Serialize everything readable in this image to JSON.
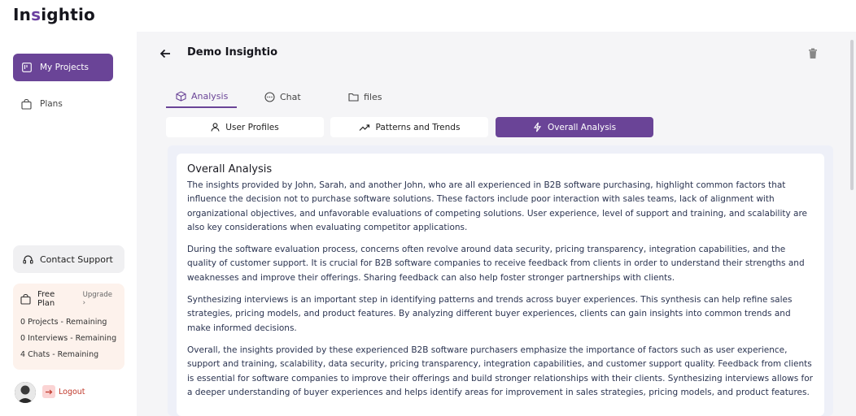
{
  "brand": {
    "logo_pre": "In",
    "logo_mid": "s",
    "logo_post": "ightio"
  },
  "sidebar": {
    "items": [
      {
        "label": "My Projects",
        "icon": "board-icon",
        "active": true
      },
      {
        "label": "Plans",
        "icon": "bag-icon",
        "active": false
      }
    ],
    "support_label": "Contact Support",
    "plan": {
      "name": "Free Plan",
      "upgrade_label": "Upgrade",
      "lines": [
        "0 Projects - Remaining",
        "0 Interviews - Remaining",
        "4 Chats - Remaining"
      ]
    },
    "logout_label": "Logout"
  },
  "header": {
    "title": "Demo Insightio"
  },
  "tabs": [
    {
      "label": "Analysis",
      "icon": "cube-icon",
      "active": true
    },
    {
      "label": "Chat",
      "icon": "chat-bubble-icon",
      "active": false
    },
    {
      "label": "files",
      "icon": "folder-icon",
      "active": false
    }
  ],
  "segments": [
    {
      "label": "User Profiles",
      "icon": "user-icon",
      "active": false
    },
    {
      "label": "Patterns and Trends",
      "icon": "trend-icon",
      "active": false
    },
    {
      "label": "Overall Analysis",
      "icon": "bolt-icon",
      "active": true
    }
  ],
  "analysis": {
    "title": "Overall Analysis",
    "paragraphs": [
      "The insights provided by John, Sarah, and another John, who are all experienced in B2B software purchasing, highlight common factors that influence the decision not to purchase software solutions. These factors include poor interaction with sales teams, lack of alignment with organizational objectives, and unfavorable evaluations of competing solutions. User experience, level of support and training, and scalability are also key considerations when evaluating competitor applications.",
      "During the software evaluation process, concerns often revolve around data security, pricing transparency, integration capabilities, and the quality of customer support. It is crucial for B2B software companies to receive feedback from clients in order to understand their strengths and weaknesses and improve their offerings. Sharing feedback can also help foster stronger partnerships with clients.",
      "Synthesizing interviews is an important step in identifying patterns and trends across buyer experiences. This synthesis can help refine sales strategies, pricing models, and product features. By analyzing different buyer experiences, clients can gain insights into common trends and make informed decisions.",
      "Overall, the insights provided by these experienced B2B software purchasers emphasize the importance of factors such as user experience, support and training, scalability, data security, pricing transparency, integration capabilities, and customer support quality. Feedback from clients is essential for software companies to improve their offerings and build stronger relationships with their clients. Synthesizing interviews allows for a deeper understanding of buyer experiences and helps identify areas for improvement in sales strategies, pricing models, and product features."
    ]
  },
  "colors": {
    "accent": "#6a4497",
    "plan_bg": "#fdf2ec",
    "logout": "#c0392b"
  }
}
